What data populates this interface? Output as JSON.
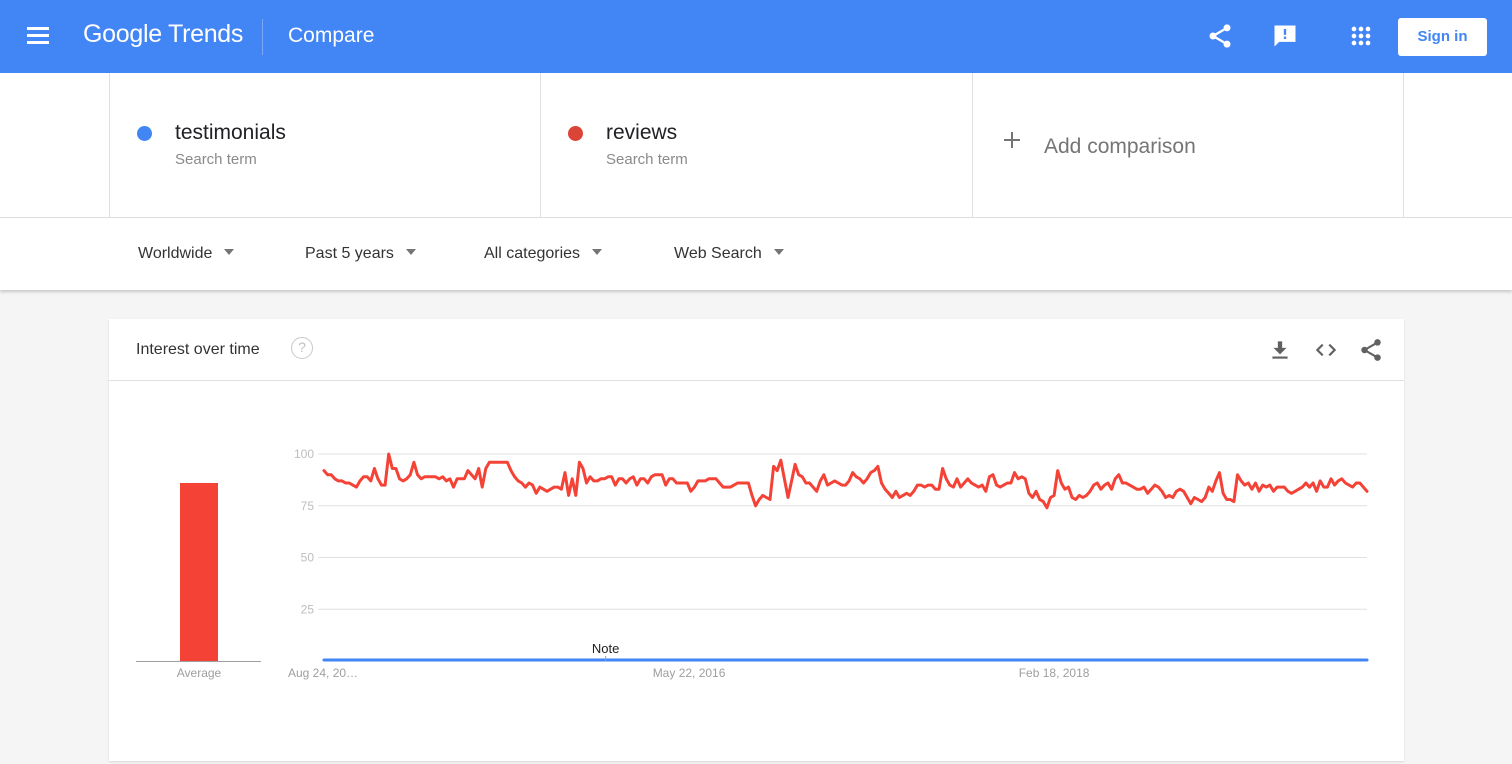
{
  "header": {
    "logo_google": "Google",
    "logo_trends": "Trends",
    "page_title": "Compare",
    "sign_in_label": "Sign in",
    "icons": [
      "share-icon",
      "feedback-icon",
      "apps-grid-icon"
    ]
  },
  "terms": [
    {
      "name": "testimonials",
      "type": "Search term",
      "color": "#4285f4"
    },
    {
      "name": "reviews",
      "type": "Search term",
      "color": "#db4437"
    }
  ],
  "add_comparison_label": "Add comparison",
  "filters": [
    {
      "label": "Worldwide"
    },
    {
      "label": "Past 5 years"
    },
    {
      "label": "All categories"
    },
    {
      "label": "Web Search"
    }
  ],
  "card": {
    "title": "Interest over time",
    "help_glyph": "?",
    "icons": [
      "download-icon",
      "embed-code-icon",
      "share-icon"
    ]
  },
  "chart_data": {
    "type": "line",
    "title": "Interest over time",
    "xlabel": "",
    "ylabel": "",
    "ylim": [
      0,
      100
    ],
    "y_ticks": [
      "25",
      "50",
      "75",
      "100"
    ],
    "x_tick_labels": [
      "Aug 24, 20…",
      "May 22, 2016",
      "Feb 18, 2018"
    ],
    "x_tick_positions": [
      0.0,
      0.35,
      0.7
    ],
    "annotation": {
      "label": "Note",
      "at": 0.27
    },
    "grid": true,
    "legend": "none",
    "average": {
      "label": "Average",
      "series": [
        {
          "name": "testimonials",
          "value": 0,
          "color": "#4285f4"
        },
        {
          "name": "reviews",
          "value": 86,
          "color": "#f44336"
        }
      ]
    },
    "series": [
      {
        "name": "testimonials",
        "color": "#4285f4",
        "values": [
          0
        ]
      },
      {
        "name": "reviews",
        "color": "#f44336",
        "values": [
          92,
          90,
          90,
          88,
          87,
          87,
          86,
          86,
          85,
          84,
          87,
          89,
          89,
          87,
          93,
          88,
          85,
          85,
          100,
          93,
          93,
          88,
          87,
          88,
          90,
          96,
          90,
          88,
          89,
          89,
          89,
          89,
          88,
          89,
          87,
          88,
          84,
          88,
          88,
          88,
          92,
          90,
          88,
          93,
          84,
          93,
          96,
          96,
          96,
          96,
          96,
          96,
          92,
          89,
          87,
          86,
          84,
          86,
          85,
          81,
          84,
          83,
          82,
          83,
          84,
          84,
          83,
          91,
          80,
          88,
          80,
          96,
          93,
          86,
          89,
          87,
          87,
          88,
          88,
          89,
          89,
          85,
          88,
          88,
          86,
          88,
          89,
          85,
          88,
          88,
          86,
          89,
          90,
          90,
          90,
          85,
          88,
          88,
          86,
          86,
          86,
          86,
          82,
          84,
          87,
          87,
          87,
          88,
          88,
          88,
          86,
          84,
          84,
          84,
          85,
          86,
          86,
          86,
          86,
          80,
          75,
          78,
          80,
          79,
          78,
          94,
          92,
          97,
          88,
          79,
          87,
          95,
          90,
          89,
          86,
          86,
          84,
          82,
          87,
          90,
          85,
          86,
          87,
          86,
          85,
          85,
          87,
          91,
          89,
          88,
          86,
          88,
          91,
          92,
          94,
          86,
          83,
          81,
          79,
          82,
          79,
          80,
          81,
          80,
          82,
          85,
          85,
          84,
          85,
          85,
          83,
          83,
          93,
          88,
          85,
          84,
          88,
          84,
          86,
          88,
          86,
          85,
          84,
          85,
          82,
          89,
          90,
          85,
          84,
          85,
          86,
          86,
          91,
          88,
          89,
          88,
          81,
          79,
          82,
          78,
          77,
          74,
          79,
          80,
          92,
          86,
          83,
          84,
          79,
          78,
          80,
          79,
          80,
          82,
          85,
          86,
          83,
          85,
          86,
          83,
          88,
          90,
          86,
          86,
          85,
          84,
          83,
          83,
          84,
          81,
          83,
          85,
          84,
          82,
          79,
          80,
          79,
          82,
          83,
          82,
          79,
          76,
          79,
          78,
          77,
          79,
          84,
          82,
          87,
          91,
          81,
          78,
          78,
          77,
          90,
          87,
          85,
          86,
          83,
          86,
          82,
          85,
          84,
          85,
          82,
          84,
          84,
          84,
          82,
          81,
          82,
          83,
          84,
          86,
          84,
          86,
          82,
          87,
          84,
          84,
          88,
          85,
          87,
          88,
          86,
          85,
          84,
          86,
          86,
          84,
          82
        ]
      }
    ]
  }
}
